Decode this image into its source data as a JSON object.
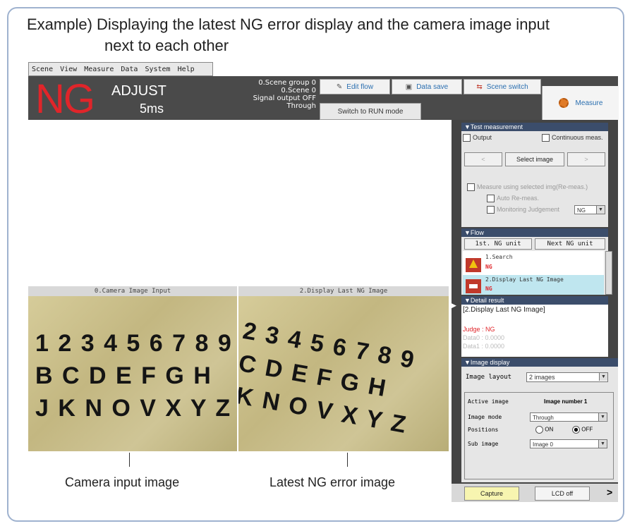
{
  "caption": {
    "line1": "Example) Displaying the latest NG error display and the camera image input",
    "line2": "next to each other"
  },
  "menu": [
    "Scene",
    "View",
    "Measure",
    "Data",
    "System",
    "Help"
  ],
  "header": {
    "judgement": "NG",
    "mode": "ADJUST",
    "time": "5ms",
    "scene_group": "0.Scene group 0",
    "scene": "0.Scene 0",
    "signal_output": "Signal output OFF",
    "through": "Through",
    "edit_flow": "Edit flow",
    "data_save": "Data save",
    "scene_switch": "Scene switch",
    "switch_run": "Switch to RUN mode",
    "measure": "Measure"
  },
  "images": {
    "left_title": "0.Camera Image Input",
    "right_title": "2.Display Last NG Image",
    "left_chars": [
      "1 2 3 4 5 6 7 8 9",
      "B C D E F G H",
      "J K N O V X Y Z"
    ],
    "right_chars": [
      "2 3 4 5 6 7 8 9",
      "C D E F G H",
      "K N O V X Y Z"
    ],
    "left_label": "Camera input image",
    "right_label": "Latest NG error image"
  },
  "test_measurement": {
    "title": "▼Test measurement",
    "output": "Output",
    "continuous": "Continuous meas.",
    "select_image": "Select image",
    "measure_selected": "Measure using selected img(Re-meas.)",
    "auto_remeas": "Auto Re-meas.",
    "monitoring": "Monitoring Judgement",
    "monitoring_value": "NG"
  },
  "flow": {
    "title": "▼Flow",
    "first_ng": "1st. NG unit",
    "next_ng": "Next NG unit",
    "items": [
      {
        "name": "1.Search",
        "status": "NG"
      },
      {
        "name": "2.Display Last NG Image",
        "status": "NG"
      }
    ]
  },
  "detail": {
    "title": "▼Detail result",
    "unit": "[2.Display Last NG Image]",
    "judge": "Judge : NG",
    "data0": "Data0 : 0.0000",
    "data1": "Data1 : 0.0000"
  },
  "image_display": {
    "title": "▼Image display",
    "layout_label": "Image layout",
    "layout_value": "2 images",
    "active_label": "Active image",
    "active_value": "Image number 1",
    "mode_label": "Image mode",
    "mode_value": "Through",
    "positions_label": "Positions",
    "on": "ON",
    "off": "OFF",
    "sub_label": "Sub image",
    "sub_value": "Image 0"
  },
  "footer": {
    "capture": "Capture",
    "lcd_off": "LCD off",
    "more": ">"
  }
}
